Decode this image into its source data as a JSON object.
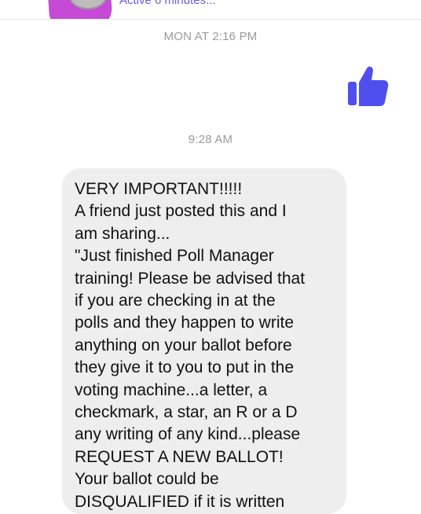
{
  "header": {
    "active_status": "Active 6 minutes..."
  },
  "timestamps": {
    "first": "MON AT 2:16 PM",
    "second": "9:28 AM"
  },
  "reaction": {
    "icon": "thumbs-up-icon",
    "color": "#4f4ff0"
  },
  "message": {
    "lines": [
      "VERY IMPORTANT!!!!!",
      "A friend just posted this and I",
      "am sharing...",
      "\"Just finished Poll Manager",
      "training! Please be advised that",
      "if you are checking in at the",
      "polls and they happen to write",
      "anything on your ballot before",
      "they give it to you to put in the",
      "voting machine...a letter, a",
      "checkmark, a star, an R or a D",
      "any writing of any kind...please",
      "REQUEST A NEW BALLOT!",
      "Your ballot could be",
      "DISQUALIFIED if it is written"
    ]
  },
  "colors": {
    "bubble": "#eeeeee",
    "timestamp": "#9b9b9b",
    "accent": "#6a5de0",
    "highlight": "#c54bd6"
  }
}
